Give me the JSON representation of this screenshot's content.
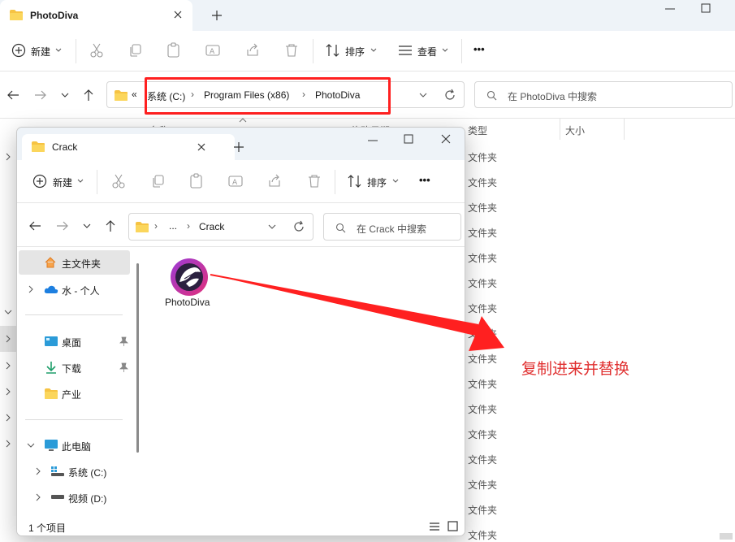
{
  "back_window": {
    "tab_title": "PhotoDiva",
    "toolbar": {
      "new_label": "新建",
      "sort_label": "排序",
      "view_label": "查看",
      "more_label": "•••"
    },
    "address": {
      "prefix": "«",
      "segments": [
        "系统 (C:)",
        "Program Files (x86)",
        "PhotoDiva"
      ]
    },
    "search_placeholder": "在 PhotoDiva 中搜索",
    "columns": {
      "name": "名称",
      "modified": "修改日期",
      "type": "类型",
      "size": "大小"
    },
    "row_type": "文件夹",
    "row_count": 16
  },
  "front_window": {
    "tab_title": "Crack",
    "toolbar": {
      "new_label": "新建",
      "sort_label": "排序",
      "more_label": "•••"
    },
    "address": {
      "ellipsis": "...",
      "current": "Crack"
    },
    "search_placeholder": "在 Crack 中搜索",
    "sidebar": {
      "home": "主文件夹",
      "onedrive": "水 - 个人",
      "desktop": "桌面",
      "downloads": "下载",
      "folder": "产业",
      "this_pc": "此电脑",
      "drive_c": "系统 (C:)",
      "drive_d": "视频 (D:)"
    },
    "file": {
      "name": "PhotoDiva"
    },
    "status": "1 个项目"
  },
  "annotation": {
    "text": "复制进来并替换",
    "color": "#e03030"
  },
  "colors": {
    "highlight": "#ff2020",
    "accent_folder": "#f6c343",
    "selection": "#e5e5e5"
  }
}
